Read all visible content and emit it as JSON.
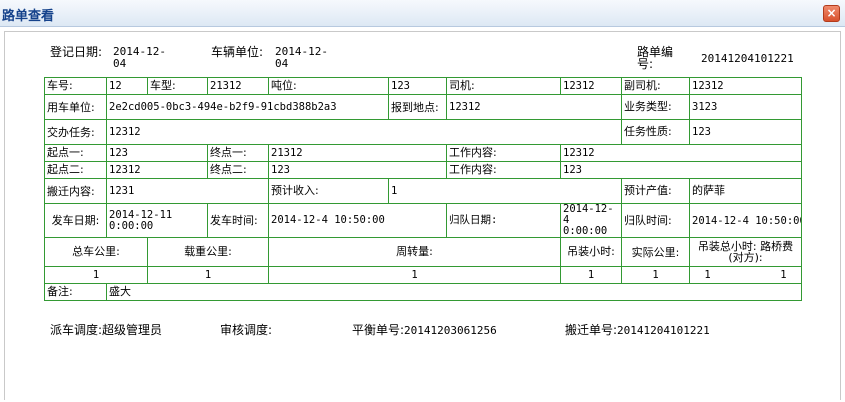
{
  "window": {
    "title": "路单查看",
    "close_label": "×"
  },
  "header": {
    "reg_date_label": "登记日期:",
    "reg_date_value": "2014-12-04",
    "vehicle_unit_label": "车辆单位:",
    "vehicle_unit_value": "2014-12-04",
    "route_no_label": "路单编号:",
    "route_no_value": "20141204101221"
  },
  "rows": {
    "r1": {
      "car_no_label": "车号:",
      "car_no": "12",
      "car_type_label": "车型:",
      "car_type": "21312",
      "tonnage_label": "吨位:",
      "tonnage": "123",
      "driver_label": "司机:",
      "driver": "12312",
      "co_driver_label": "副司机:",
      "co_driver": "12312"
    },
    "r2": {
      "use_unit_label": "用车单位:",
      "use_unit": "2e2cd005-0bc3-494e-b2f9-91cbd388b2a3",
      "report_place_label": "报到地点:",
      "report_place": "12312",
      "biz_type_label": "业务类型:",
      "biz_type": "3123"
    },
    "r3": {
      "task_label": "交办任务:",
      "task": "12312",
      "task_nature_label": "任务性质:",
      "task_nature": "123"
    },
    "r4": {
      "start1_label": "起点一:",
      "start1": "123",
      "end1_label": "终点一:",
      "end1": "21312",
      "work1_label": "工作内容:",
      "work1": "12312"
    },
    "r5": {
      "start2_label": "起点二:",
      "start2": "12312",
      "end2_label": "终点二:",
      "end2": "123",
      "work2_label": "工作内容:",
      "work2": "123"
    },
    "r6": {
      "move_label": "搬迁内容:",
      "move": "1231",
      "est_income_label": "预计收入:",
      "est_income": "1",
      "est_output_label": "预计产值:",
      "est_output": "的萨菲"
    },
    "r7": {
      "depart_date_label": "发车日期:",
      "depart_date": "2014-12-11 0:00:00",
      "depart_time_label": "发车时间:",
      "depart_time": "2014-12-4 10:50:00",
      "return_date_label": "归队日期:",
      "return_date": "2014-12-4 0:00:00",
      "return_time_label": "归队时间:",
      "return_time": "2014-12-4 10:50:00"
    },
    "r8": {
      "total_km": "总车公里:",
      "load_km": "载重公里:",
      "turnover": "周转量:",
      "lift_hours": "吊装小时:",
      "actual_km": "实际公里:",
      "lift_total_hours": "吊装总小时:",
      "toll": "路桥费(对方):"
    },
    "r9": {
      "total_km": "1",
      "load_km": "1",
      "turnover": "1",
      "lift_hours": "1",
      "actual_km": "1",
      "lift_total_hours": "1",
      "toll": "1"
    },
    "r10": {
      "remark_label": "备注:",
      "remark": "盛大"
    }
  },
  "footer": {
    "dispatcher_label": "派车调度:",
    "dispatcher": "超级管理员",
    "auditor_label": "审核调度:",
    "balance_no_label": "平衡单号:",
    "balance_no": "20141203061256",
    "move_no_label": "搬迁单号:",
    "move_no": "20141204101221"
  }
}
